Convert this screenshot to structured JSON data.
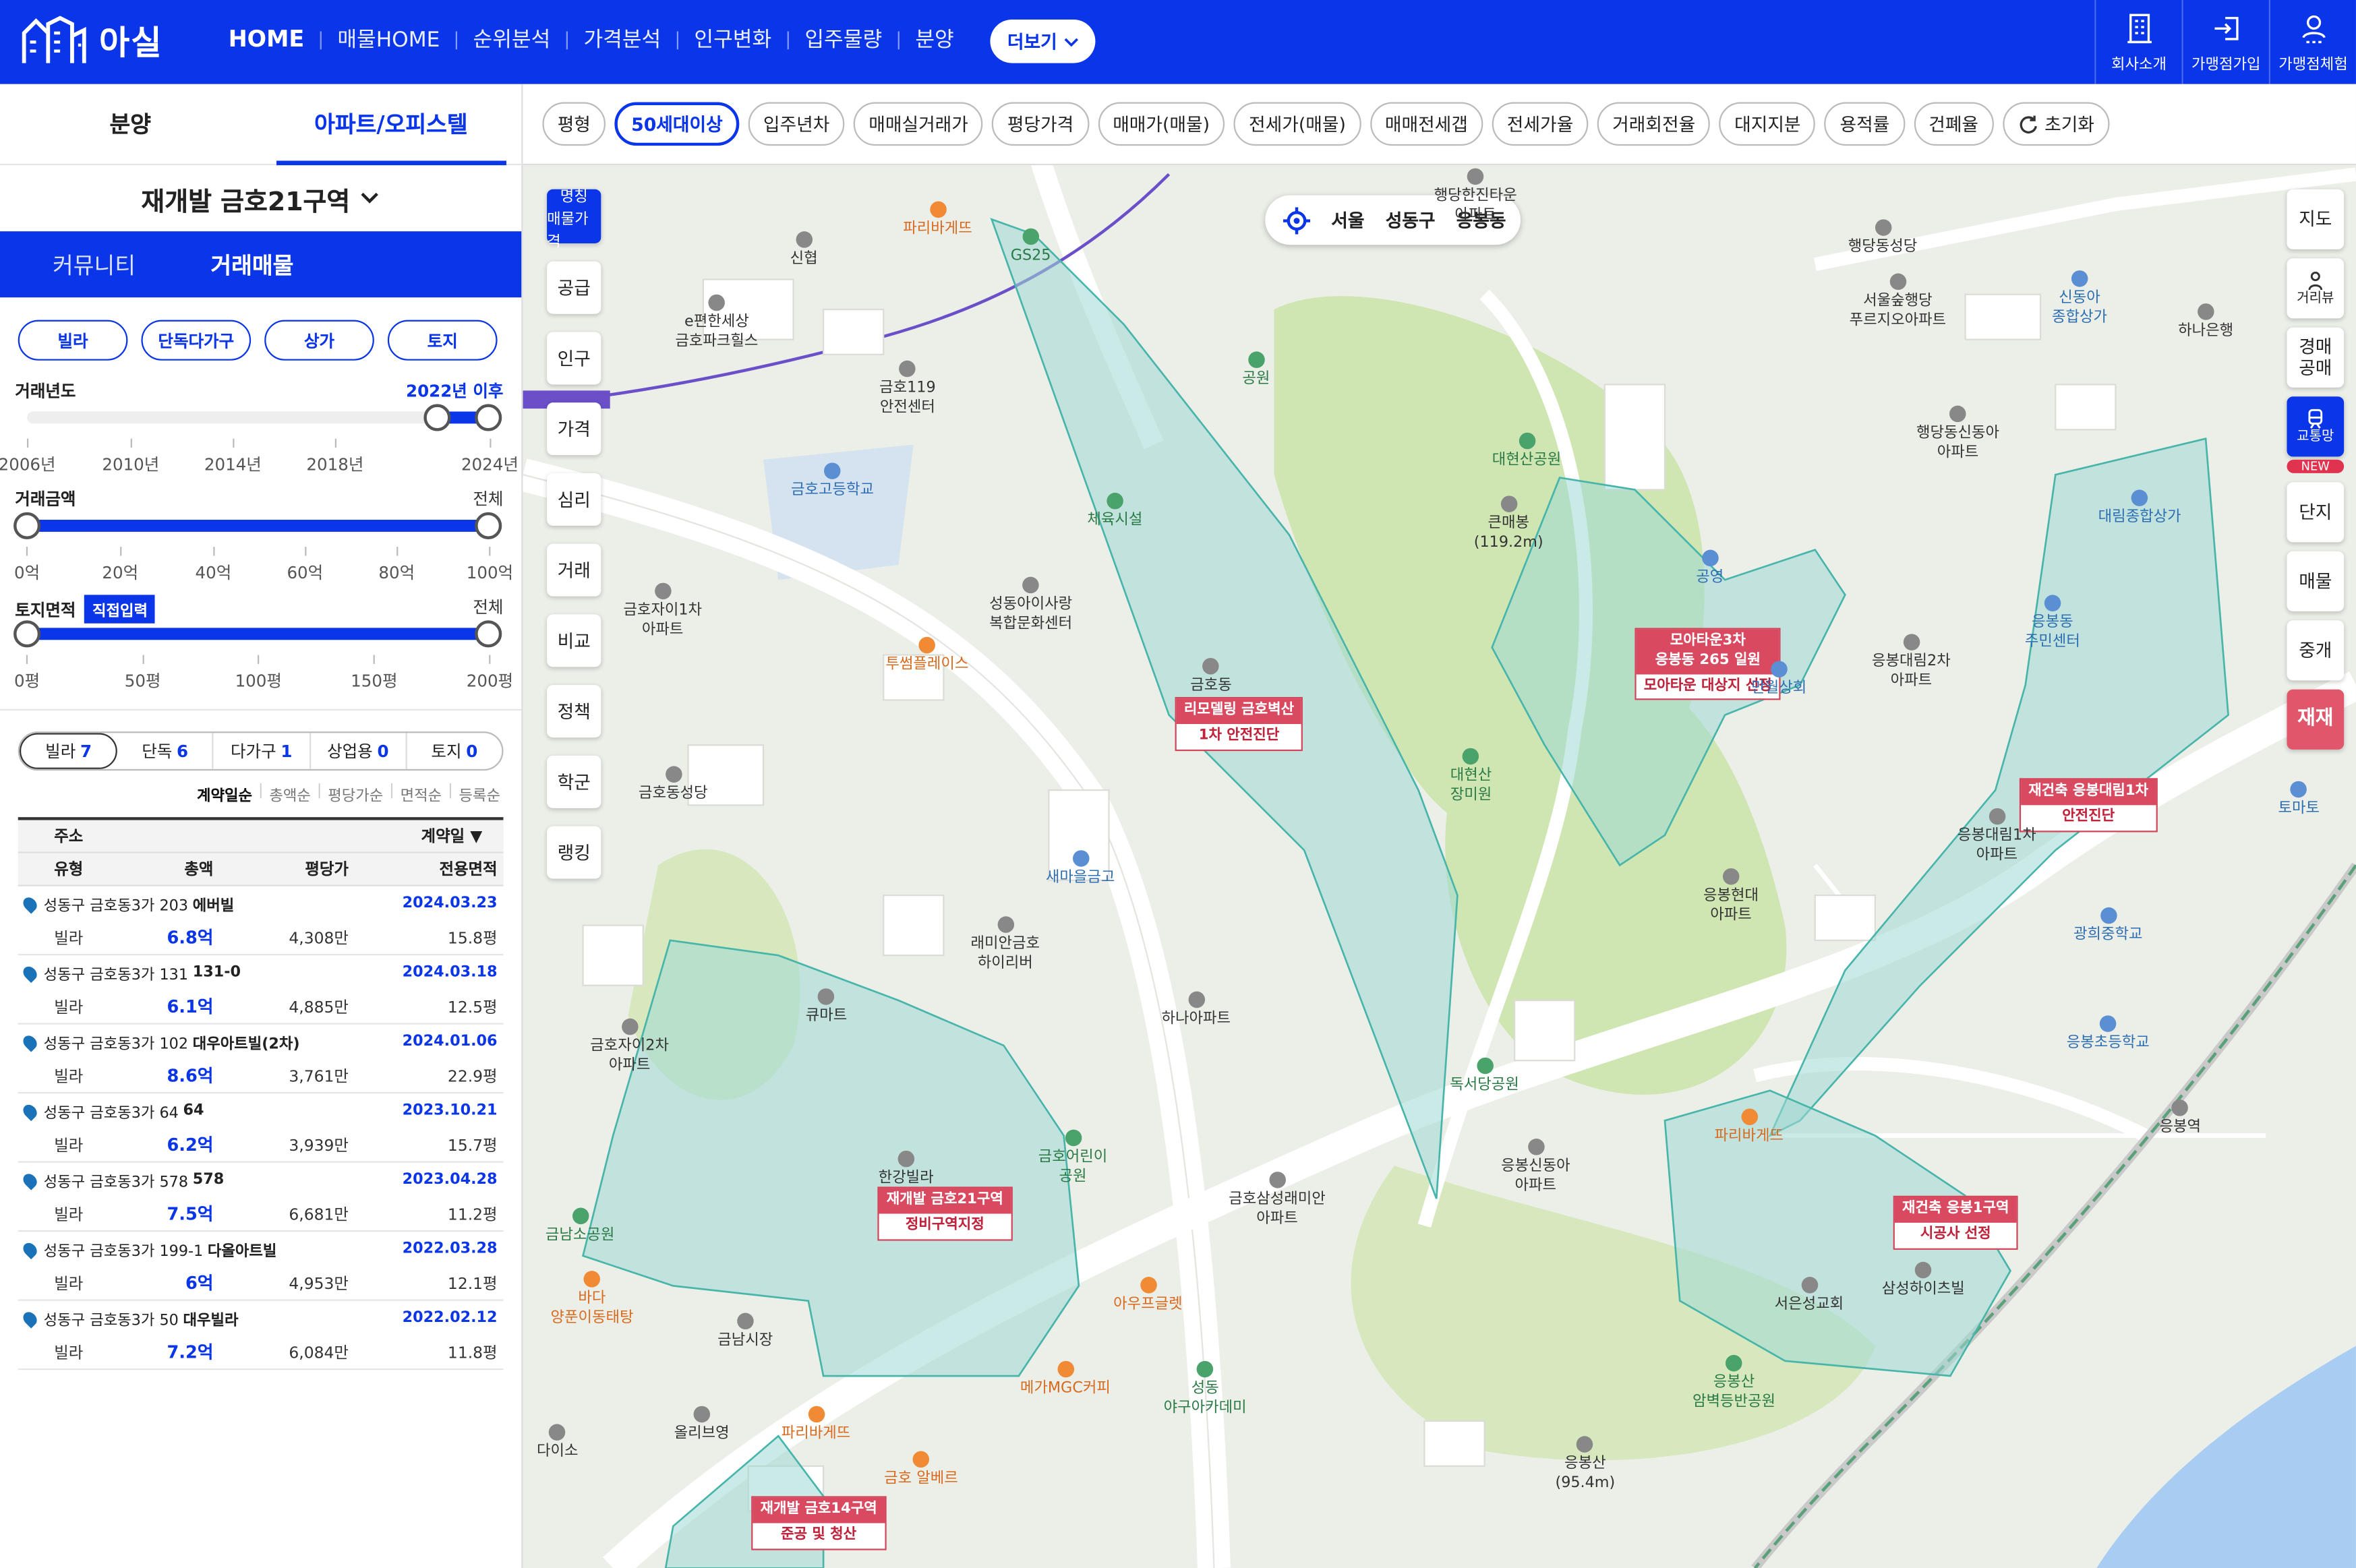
{
  "header": {
    "logo_text": "아실",
    "nav": [
      "HOME",
      "매물HOME",
      "순위분석",
      "가격분석",
      "인구변화",
      "입주물량",
      "분양"
    ],
    "more_label": "더보기",
    "right_buttons": [
      "회사소개",
      "가맹점가입",
      "가맹점체험"
    ],
    "brand_color": "#0a35e8"
  },
  "left": {
    "tabs": [
      "분양",
      "아파트/오피스텔"
    ],
    "region": "재개발 금호21구역",
    "subtabs": [
      "커뮤니티",
      "거래매물"
    ],
    "type_buttons": [
      "빌라",
      "단독다가구",
      "상가",
      "토지"
    ],
    "filters": {
      "year": {
        "label": "거래년도",
        "value": "2022년 이후",
        "ticks": [
          "2006년",
          "2010년",
          "2014년",
          "2018년",
          "2024년"
        ],
        "range": [
          2022,
          2024
        ]
      },
      "price": {
        "label": "거래금액",
        "value": "전체",
        "ticks": [
          "0억",
          "20억",
          "40억",
          "60억",
          "80억",
          "100억"
        ]
      },
      "land": {
        "label": "토지면적",
        "direct": "직접입력",
        "value": "전체",
        "ticks": [
          "0평",
          "50평",
          "100평",
          "150평",
          "200평"
        ]
      }
    },
    "categories": [
      {
        "label": "빌라",
        "count": "7"
      },
      {
        "label": "단독",
        "count": "6"
      },
      {
        "label": "다가구",
        "count": "1"
      },
      {
        "label": "상업용",
        "count": "0"
      },
      {
        "label": "토지",
        "count": "0"
      }
    ],
    "sorts": [
      "계약일순",
      "총액순",
      "평당가순",
      "면적순",
      "등록순"
    ],
    "table_headers": {
      "address": "주소",
      "contract": "계약일 ▼",
      "type": "유형",
      "total": "총액",
      "per_pyeong": "평당가",
      "area": "전용면적"
    },
    "rows": [
      {
        "addr": "성동구 금호동3가 203",
        "name": "에버빌",
        "date": "2024.03.23",
        "type": "빌라",
        "price": "6.8억",
        "pp": "4,308만",
        "area": "15.8평"
      },
      {
        "addr": "성동구 금호동3가 131",
        "name": "131-0",
        "date": "2024.03.18",
        "type": "빌라",
        "price": "6.1억",
        "pp": "4,885만",
        "area": "12.5평"
      },
      {
        "addr": "성동구 금호동3가 102",
        "name": "대우아트빌(2차)",
        "date": "2024.01.06",
        "type": "빌라",
        "price": "8.6억",
        "pp": "3,761만",
        "area": "22.9평"
      },
      {
        "addr": "성동구 금호동3가 64",
        "name": "64",
        "date": "2023.10.21",
        "type": "빌라",
        "price": "6.2억",
        "pp": "3,939만",
        "area": "15.7평"
      },
      {
        "addr": "성동구 금호동3가 578",
        "name": "578",
        "date": "2023.04.28",
        "type": "빌라",
        "price": "7.5억",
        "pp": "6,681만",
        "area": "11.2평"
      },
      {
        "addr": "성동구 금호동3가 199-1",
        "name": "다올아트빌",
        "date": "2022.03.28",
        "type": "빌라",
        "price": "6억",
        "pp": "4,953만",
        "area": "12.1평"
      },
      {
        "addr": "성동구 금호동3가 50",
        "name": "대우빌라",
        "date": "2022.02.12",
        "type": "빌라",
        "price": "7.2억",
        "pp": "6,084만",
        "area": "11.8평"
      }
    ]
  },
  "map": {
    "chips": [
      "평형",
      "50세대이상",
      "입주년차",
      "매매실거래가",
      "평당가격",
      "매매가(매물)",
      "전세가(매물)",
      "매매전세갭",
      "전세가율",
      "거래회전율",
      "대지지분",
      "용적률",
      "건폐율",
      "초기화"
    ],
    "location": [
      "서울",
      "성동구",
      "응봉동"
    ],
    "left_side": {
      "top": [
        "명칭",
        "매물가격"
      ],
      "items": [
        "공급",
        "인구",
        "가격",
        "심리",
        "거래",
        "비교",
        "정책",
        "학군",
        "랭킹"
      ]
    },
    "right_side": {
      "items": [
        "지도",
        "거리뷰",
        "경매\n공매",
        "교통망",
        "단지",
        "매물",
        "중개",
        "재재"
      ],
      "new_badge": "NEW"
    },
    "zones": [
      {
        "title": "리모델링 금호벽산",
        "sub": "1차 안전진단"
      },
      {
        "title": "모아타운3차\n응봉동 265 일원",
        "sub": "모아타운 대상지 선정"
      },
      {
        "title": "재건축 응봉대림1차",
        "sub": "안전진단"
      },
      {
        "title": "재개발 금호21구역",
        "sub": "정비구역지정"
      },
      {
        "title": "재건축 응봉1구역",
        "sub": "시공사 선정"
      },
      {
        "title": "재개발 금호14구역",
        "sub": "준공 및 청산"
      }
    ],
    "pois": [
      {
        "name": "파리바게뜨",
        "kind": "orange"
      },
      {
        "name": "신협",
        "kind": "gray"
      },
      {
        "name": "GS25",
        "kind": "green"
      },
      {
        "name": "e편한세상\n금호파크힐스",
        "kind": "gray"
      },
      {
        "name": "금호119\n안전센터",
        "kind": "gray"
      },
      {
        "name": "금호고등학교",
        "kind": "blue"
      },
      {
        "name": "체육시설",
        "kind": "green"
      },
      {
        "name": "공원",
        "kind": "green"
      },
      {
        "name": "대현산공원",
        "kind": "green"
      },
      {
        "name": "큰매봉\n(119.2m)",
        "kind": "gray"
      },
      {
        "name": "금호자이1차\n아파트",
        "kind": "gray"
      },
      {
        "name": "성동아이사랑\n복합문화센터",
        "kind": "gray"
      },
      {
        "name": "투썸플레이스",
        "kind": "orange"
      },
      {
        "name": "금호동",
        "kind": "gray"
      },
      {
        "name": "대현산\n장미원",
        "kind": "green"
      },
      {
        "name": "금호동성당",
        "kind": "gray"
      },
      {
        "name": "새마을금고",
        "kind": "blue"
      },
      {
        "name": "래미안금호\n하이리버",
        "kind": "gray"
      },
      {
        "name": "큐마트",
        "kind": "gray"
      },
      {
        "name": "금호자이2차\n아파트",
        "kind": "gray"
      },
      {
        "name": "하나아파트",
        "kind": "gray"
      },
      {
        "name": "한강빌라",
        "kind": "gray"
      },
      {
        "name": "금호어린이\n공원",
        "kind": "green"
      },
      {
        "name": "금남소공원",
        "kind": "green"
      },
      {
        "name": "바다\n양푼이동태탕",
        "kind": "orange"
      },
      {
        "name": "금남시장",
        "kind": "gray"
      },
      {
        "name": "아우프글렛",
        "kind": "orange"
      },
      {
        "name": "금호삼성래미안\n아파트",
        "kind": "gray"
      },
      {
        "name": "메가MGC커피",
        "kind": "orange"
      },
      {
        "name": "성동\n야구아카데미",
        "kind": "green"
      },
      {
        "name": "올리브영",
        "kind": "gray"
      },
      {
        "name": "다이소",
        "kind": "gray"
      },
      {
        "name": "파리바게뜨",
        "kind": "orange"
      },
      {
        "name": "금호 알베르",
        "kind": "orange"
      },
      {
        "name": "응봉신동아\n아파트",
        "kind": "gray"
      },
      {
        "name": "독서당공원",
        "kind": "green"
      },
      {
        "name": "응봉현대\n아파트",
        "kind": "gray"
      },
      {
        "name": "만월상회",
        "kind": "blue"
      },
      {
        "name": "응봉대림2차\n아파트",
        "kind": "gray"
      },
      {
        "name": "행당동성당",
        "kind": "gray"
      },
      {
        "name": "서울숲행당\n푸르지오아파트",
        "kind": "gray"
      },
      {
        "name": "행당동신동아\n아파트",
        "kind": "gray"
      },
      {
        "name": "신동아\n종합상가",
        "kind": "blue"
      },
      {
        "name": "하나은행",
        "kind": "gray"
      },
      {
        "name": "대림종합상가",
        "kind": "blue"
      },
      {
        "name": "응봉동\n주민센터",
        "kind": "blue"
      },
      {
        "name": "응봉대림1차\n아파트",
        "kind": "gray"
      },
      {
        "name": "광희중학교",
        "kind": "blue"
      },
      {
        "name": "응봉초등학교",
        "kind": "blue"
      },
      {
        "name": "응봉역",
        "kind": "gray"
      },
      {
        "name": "파리바게뜨",
        "kind": "orange"
      },
      {
        "name": "서은성교회",
        "kind": "gray"
      },
      {
        "name": "삼성하이츠빌",
        "kind": "gray"
      },
      {
        "name": "응봉산\n암벽등반공원",
        "kind": "green"
      },
      {
        "name": "응봉산\n(95.4m)",
        "kind": "gray"
      },
      {
        "name": "토마토",
        "kind": "blue"
      },
      {
        "name": "공영",
        "kind": "blue"
      },
      {
        "name": "행당한진타운\n아파트",
        "kind": "gray"
      }
    ]
  }
}
